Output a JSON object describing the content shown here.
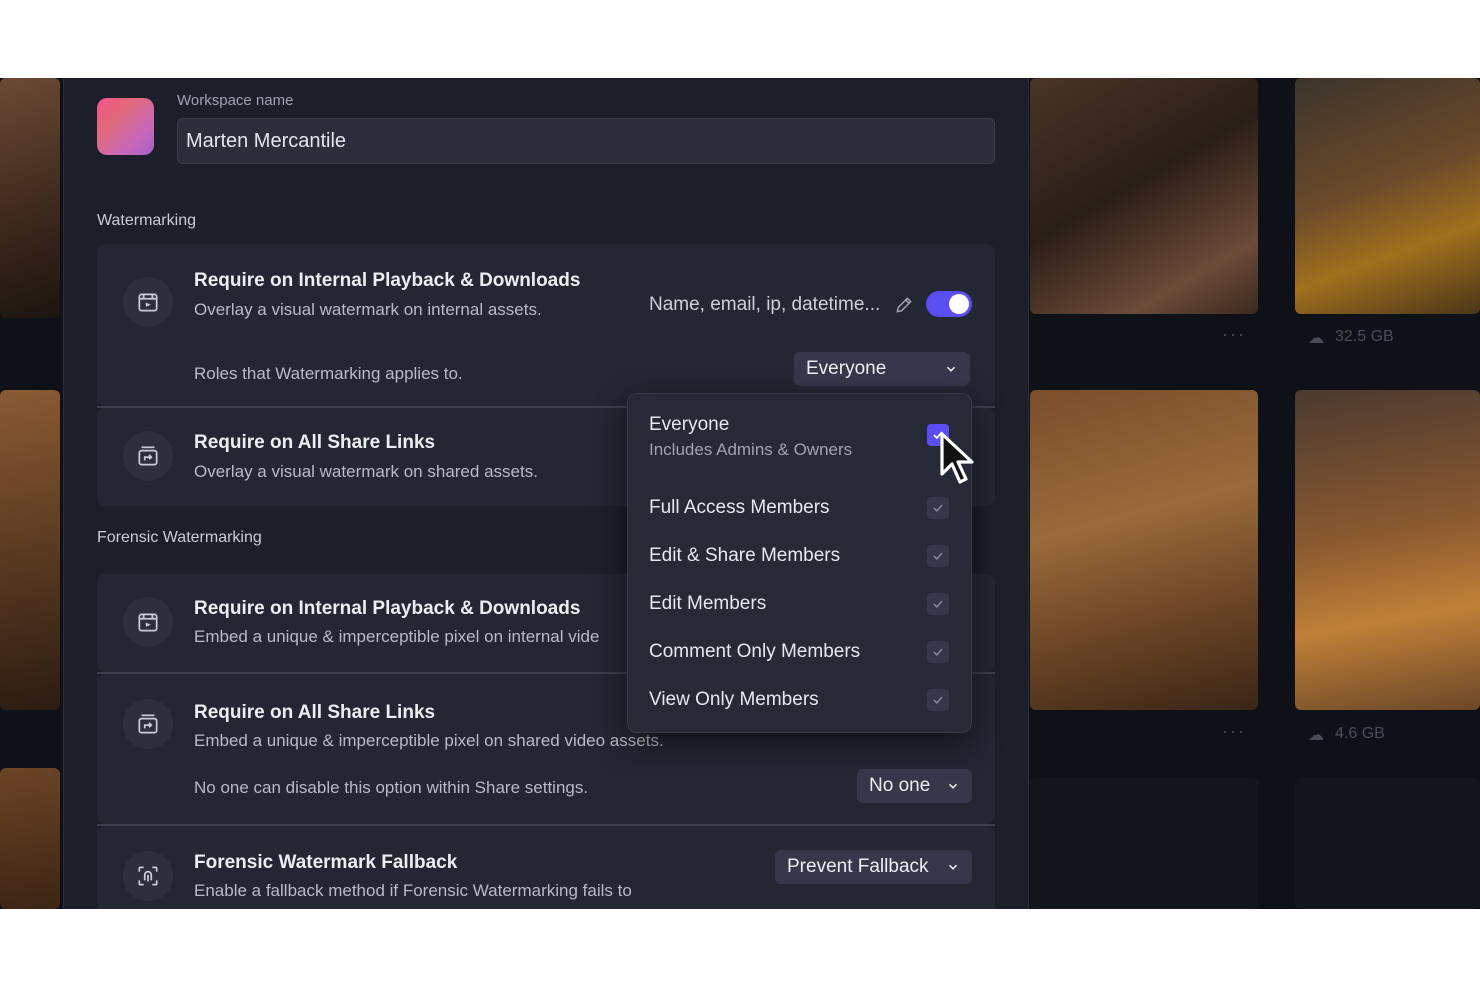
{
  "workspace": {
    "label": "Workspace name",
    "name": "Marten Mercantile"
  },
  "watermarking": {
    "section_title": "Watermarking",
    "internal": {
      "title": "Require on Internal Playback & Downloads",
      "subtitle": "Overlay a visual watermark on internal assets.",
      "fields": "Name, email, ip, datetime...",
      "enabled": true,
      "roles_note": "Roles that Watermarking applies to.",
      "roles_value": "Everyone"
    },
    "share_links": {
      "title": "Require on All Share Links",
      "subtitle": "Overlay a visual watermark on shared assets."
    }
  },
  "forensic": {
    "section_title": "Forensic Watermarking",
    "internal": {
      "title": "Require on Internal Playback & Downloads",
      "subtitle": "Embed a unique & imperceptible pixel on internal vide"
    },
    "share_links": {
      "title": "Require on All Share Links",
      "subtitle": "Embed a unique & imperceptible pixel on shared video assets.",
      "disable_note": "No one can disable this option within Share settings.",
      "disable_value": "No one"
    },
    "fallback": {
      "title": "Forensic Watermark Fallback",
      "subtitle": "Enable a fallback method if Forensic Watermarking fails to",
      "value": "Prevent Fallback"
    }
  },
  "roles_menu": {
    "items": [
      {
        "label": "Everyone",
        "sub": "Includes Admins & Owners",
        "checked": true
      },
      {
        "label": "Full Access Members",
        "checked": true
      },
      {
        "label": "Edit & Share Members",
        "checked": true
      },
      {
        "label": "Edit Members",
        "checked": true
      },
      {
        "label": "Comment Only Members",
        "checked": true
      },
      {
        "label": "View Only Members",
        "checked": true
      }
    ]
  },
  "background": {
    "size_1": "32.5 GB",
    "size_2": "4.6 GB",
    "more": "···"
  },
  "colors": {
    "accent": "#5b4ef0",
    "panel": "#1c1e29",
    "card": "#232633"
  }
}
